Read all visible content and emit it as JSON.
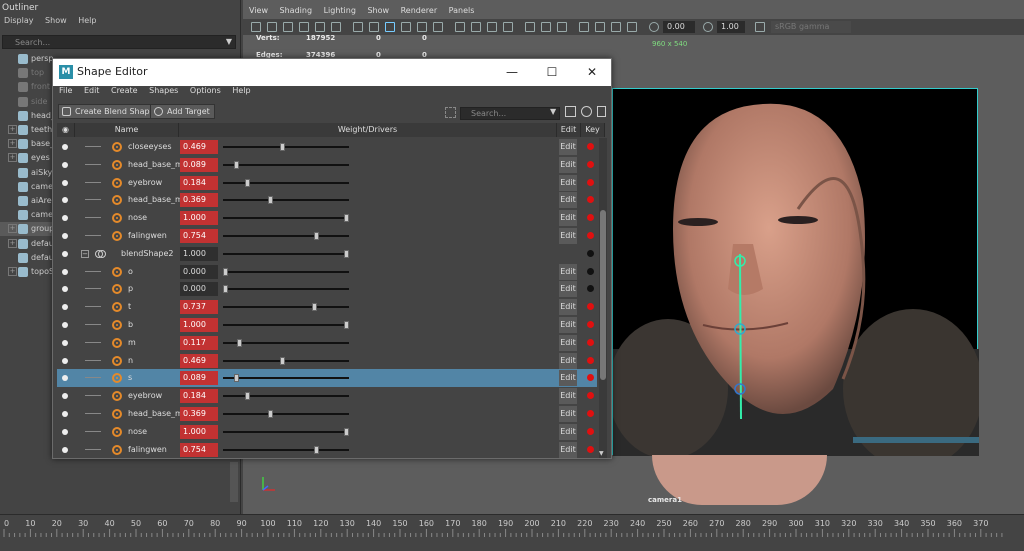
{
  "outliner": {
    "title": "Outliner",
    "menu": [
      "Display",
      "Show",
      "Help"
    ],
    "search_placeholder": "Search...",
    "items": [
      {
        "label": "persp",
        "dim": false,
        "expand": ""
      },
      {
        "label": "top",
        "dim": true,
        "expand": ""
      },
      {
        "label": "front",
        "dim": true,
        "expand": ""
      },
      {
        "label": "side",
        "dim": true,
        "expand": ""
      },
      {
        "label": "head_",
        "dim": false,
        "expand": ""
      },
      {
        "label": "teeth",
        "dim": false,
        "expand": "+"
      },
      {
        "label": "base_",
        "dim": false,
        "expand": "+"
      },
      {
        "label": "eyes",
        "dim": false,
        "expand": "+"
      },
      {
        "label": "aiSkyD",
        "dim": false,
        "expand": ""
      },
      {
        "label": "camer",
        "dim": false,
        "expand": ""
      },
      {
        "label": "aiArea",
        "dim": false,
        "expand": ""
      },
      {
        "label": "camer",
        "dim": false,
        "expand": ""
      },
      {
        "label": "group",
        "dim": false,
        "expand": "+",
        "selected": true
      },
      {
        "label": "defau",
        "dim": false,
        "expand": "+"
      },
      {
        "label": "defau",
        "dim": false,
        "expand": ""
      },
      {
        "label": "topoS",
        "dim": false,
        "expand": "+"
      }
    ]
  },
  "viewport": {
    "menu": [
      "View",
      "Shading",
      "Lighting",
      "Show",
      "Renderer",
      "Panels"
    ],
    "exposure": "0.00",
    "gamma": "1.00",
    "colorspace": "sRGB gamma",
    "hud": {
      "verts_label": "Verts:",
      "verts_value": "187952",
      "verts_a": "0",
      "verts_b": "0",
      "edges_label": "Edges:",
      "edges_value": "374396",
      "edges_a": "0",
      "edges_b": "0"
    },
    "resolution_gate": "960 x 540",
    "camera_label": "camera1"
  },
  "timeline": {
    "ticks": [
      "0",
      "10",
      "20",
      "30",
      "40",
      "50",
      "60",
      "70",
      "80",
      "90",
      "100",
      "110",
      "120",
      "130",
      "140",
      "150",
      "160",
      "170",
      "180",
      "190",
      "200",
      "210",
      "220",
      "230",
      "240",
      "250",
      "260",
      "270",
      "280",
      "290",
      "300",
      "310",
      "320",
      "330",
      "340",
      "350",
      "360",
      "370"
    ]
  },
  "shape_editor": {
    "title": "Shape Editor",
    "menu": [
      "File",
      "Edit",
      "Create",
      "Shapes",
      "Options",
      "Help"
    ],
    "create_blend_shape": "Create Blend Shape",
    "add_target": "Add Target",
    "search_placeholder": "Search...",
    "col_name": "Name",
    "col_weight": "Weight/Drivers",
    "col_edit": "Edit",
    "col_key": "Key",
    "rows": [
      {
        "type": "target",
        "name": "closeeyses",
        "weight": "0.469",
        "value": 0.469,
        "key": "red",
        "selected": false
      },
      {
        "type": "target",
        "name": "head_base_me",
        "weight": "0.089",
        "value": 0.089,
        "key": "red",
        "selected": false
      },
      {
        "type": "target",
        "name": "eyebrow",
        "weight": "0.184",
        "value": 0.184,
        "key": "red",
        "selected": false
      },
      {
        "type": "target",
        "name": "head_base_me",
        "weight": "0.369",
        "value": 0.369,
        "key": "red",
        "selected": false
      },
      {
        "type": "target",
        "name": "nose",
        "weight": "1.000",
        "value": 1.0,
        "key": "red",
        "selected": false
      },
      {
        "type": "target",
        "name": "falingwen",
        "weight": "0.754",
        "value": 0.754,
        "key": "red",
        "selected": false
      },
      {
        "type": "group",
        "name": "blendShape2",
        "weight": "1.000",
        "value": 1.0,
        "key": "black",
        "selected": false
      },
      {
        "type": "target",
        "name": "o",
        "weight": "0.000",
        "value": 0.0,
        "key": "black",
        "selected": false
      },
      {
        "type": "target",
        "name": "p",
        "weight": "0.000",
        "value": 0.0,
        "key": "black",
        "selected": false
      },
      {
        "type": "target",
        "name": "t",
        "weight": "0.737",
        "value": 0.737,
        "key": "red",
        "selected": false
      },
      {
        "type": "target",
        "name": "b",
        "weight": "1.000",
        "value": 1.0,
        "key": "red",
        "selected": false
      },
      {
        "type": "target",
        "name": "m",
        "weight": "0.117",
        "value": 0.117,
        "key": "red",
        "selected": false
      },
      {
        "type": "target",
        "name": "n",
        "weight": "0.469",
        "value": 0.469,
        "key": "red",
        "selected": false
      },
      {
        "type": "target",
        "name": "s",
        "weight": "0.089",
        "value": 0.089,
        "key": "red",
        "selected": true
      },
      {
        "type": "target",
        "name": "eyebrow",
        "weight": "0.184",
        "value": 0.184,
        "key": "red",
        "selected": false
      },
      {
        "type": "target",
        "name": "head_base_me",
        "weight": "0.369",
        "value": 0.369,
        "key": "red",
        "selected": false
      },
      {
        "type": "target",
        "name": "nose",
        "weight": "1.000",
        "value": 1.0,
        "key": "red",
        "selected": false
      },
      {
        "type": "target",
        "name": "falingwen",
        "weight": "0.754",
        "value": 0.754,
        "key": "red",
        "selected": false
      }
    ]
  },
  "colors": {
    "weight_red": "#c23232",
    "selection_blue": "#5285a6",
    "target_orange": "#e58a2a",
    "key_red": "#e01010"
  }
}
